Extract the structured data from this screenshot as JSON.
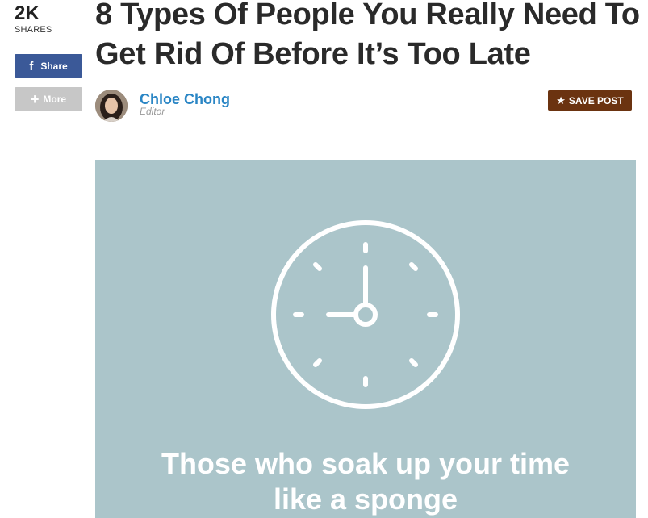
{
  "share": {
    "count": "2K",
    "count_label": "SHARES",
    "share_label": "Share",
    "share_icon": "f",
    "more_label": "More",
    "more_icon": "+",
    "facebook_color": "#3b5998"
  },
  "article": {
    "title": "8 Types Of People You Really Need To Get Rid Of Before It’s Too Late",
    "author_name": "Chloe Chong",
    "author_role": "Editor",
    "save_label": "SAVE POST",
    "save_icon": "★",
    "save_color": "#6b3310",
    "author_color": "#2b86c5"
  },
  "hero": {
    "caption_line1": "Those who soak up your time",
    "caption_line2": "like a sponge",
    "background_color": "#abc5ca",
    "icon": "clock-icon"
  }
}
